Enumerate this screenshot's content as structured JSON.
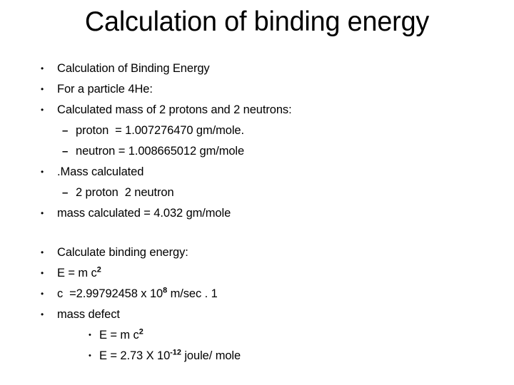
{
  "slide": {
    "title": "Calculation of binding energy",
    "background_color": "#ffffff",
    "text_color": "#000000",
    "blocks": [
      {
        "lines": [
          {
            "level": 1,
            "bullet": "round-bullet",
            "text": "Calculation of Binding Energy"
          },
          {
            "level": 1,
            "bullet": "round-bullet",
            "text": "For a particle 4He:"
          },
          {
            "level": 1,
            "bullet": "round-bullet",
            "text": "Calculated mass of 2 protons and 2 neutrons:"
          },
          {
            "level": 2,
            "bullet": "dash-bullet",
            "text": "proton  = 1.007276470 gm/mole."
          },
          {
            "level": 2,
            "bullet": "dash-bullet",
            "text": "neutron = 1.008665012 gm/mole"
          },
          {
            "level": 1,
            "bullet": "round-bullet",
            "text": ".Mass calculated"
          },
          {
            "level": 2,
            "bullet": "dash-bullet",
            "text": "2 proton  2 neutron"
          },
          {
            "level": 1,
            "bullet": "round-bullet",
            "text": "mass calculated = 4.032 gm/mole"
          }
        ]
      },
      {
        "lines": [
          {
            "level": 1,
            "bullet": "round-bullet",
            "text": "Calculate binding energy:"
          },
          {
            "level": 1,
            "bullet": "round-bullet",
            "text": "E = m c",
            "sup": "2"
          },
          {
            "level": 1,
            "bullet": "round-bullet",
            "text": "c  =2.99792458 x 10",
            "sup": "8",
            "text_after": " m/sec . 1"
          },
          {
            "level": 1,
            "bullet": "round-bullet",
            "text": "mass defect"
          },
          {
            "level": 3,
            "bullet": "round-bullet",
            "text": "E = m c",
            "sup": "2"
          },
          {
            "level": 3,
            "bullet": "round-bullet",
            "text": "E = 2.73 X 10",
            "sup": "-12",
            "text_after": " joule/ mole"
          }
        ]
      }
    ],
    "glyphs": {
      "round_bullet": "•",
      "dash_bullet": "–"
    }
  }
}
